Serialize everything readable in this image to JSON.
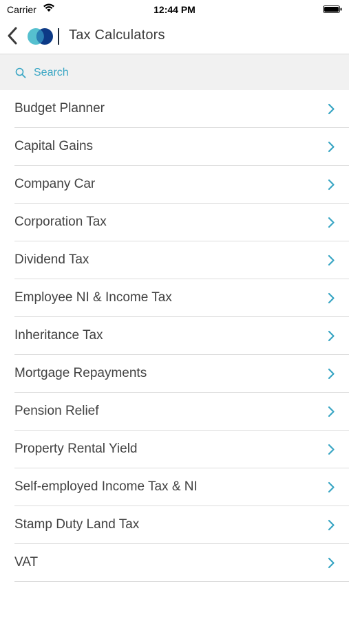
{
  "status_bar": {
    "carrier": "Carrier",
    "time": "12:44 PM"
  },
  "nav": {
    "title": "Tax Calculators",
    "back_icon": "chevron-left-icon",
    "logo_icon": "app-logo-icon"
  },
  "search": {
    "placeholder": "Search"
  },
  "items": [
    {
      "label": "Budget Planner"
    },
    {
      "label": "Capital Gains"
    },
    {
      "label": "Company Car"
    },
    {
      "label": "Corporation Tax"
    },
    {
      "label": "Dividend Tax"
    },
    {
      "label": "Employee NI & Income Tax"
    },
    {
      "label": "Inheritance Tax"
    },
    {
      "label": "Mortgage Repayments"
    },
    {
      "label": "Pension Relief"
    },
    {
      "label": "Property Rental Yield"
    },
    {
      "label": "Self-employed Income Tax & NI"
    },
    {
      "label": "Stamp Duty Land Tax"
    },
    {
      "label": "VAT"
    }
  ],
  "colors": {
    "accent": "#3aa6c4",
    "chevron": "#3aa6c4",
    "search_bg": "#f1f1f1",
    "logo_light": "#56c0cf",
    "logo_dark": "#0d3a86"
  }
}
